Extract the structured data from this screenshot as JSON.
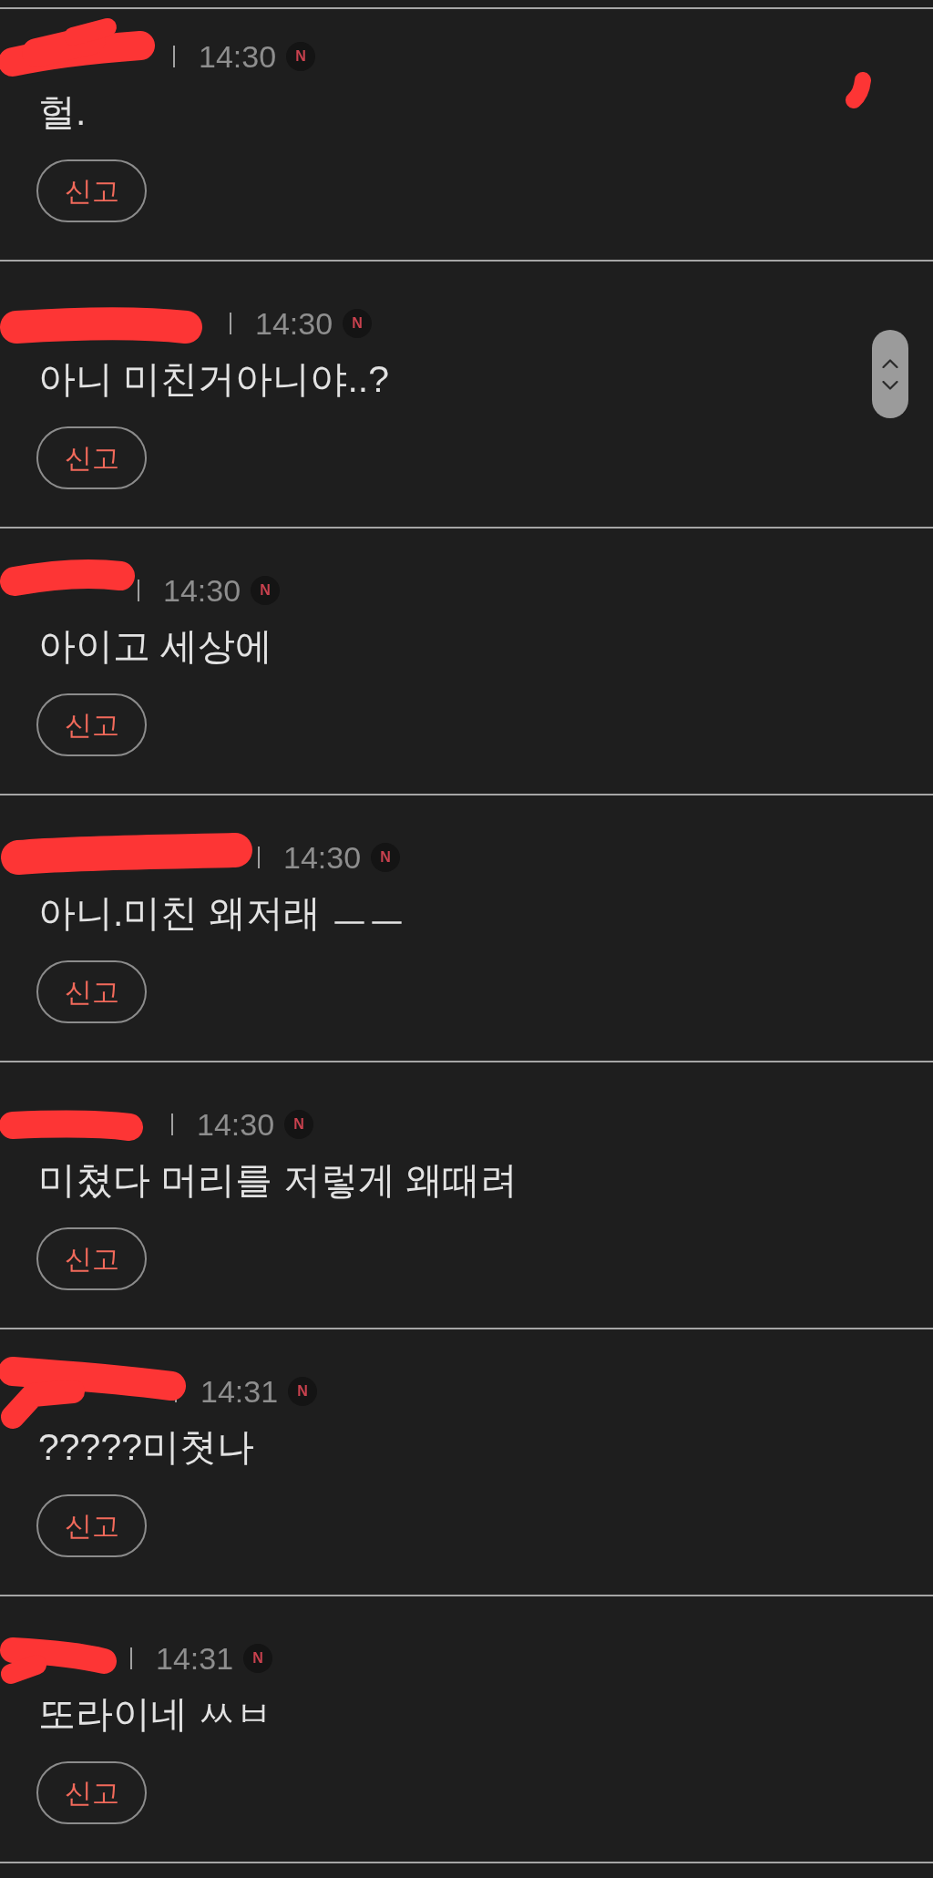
{
  "comments": [
    {
      "time": "14:30",
      "badge": "N",
      "text": "헐.",
      "report_button": "신고"
    },
    {
      "time": "14:30",
      "badge": "N",
      "text": "아니 미친거아니야..?",
      "report_button": "신고"
    },
    {
      "time": "14:30",
      "badge": "N",
      "text": "아이고 세상에",
      "report_button": "신고"
    },
    {
      "time": "14:30",
      "badge": "N",
      "text": "아니.미친 왜저래 ㅡㅡ",
      "report_button": "신고"
    },
    {
      "time": "14:30",
      "badge": "N",
      "text": "미쳤다 머리를 저렇게 왜때려",
      "report_button": "신고"
    },
    {
      "time": "14:31",
      "badge": "N",
      "text": "?????미쳣나",
      "report_button": "신고"
    },
    {
      "time": "14:31",
      "badge": "N",
      "text": "또라이네 ㅆㅂ",
      "report_button": "신고"
    }
  ]
}
